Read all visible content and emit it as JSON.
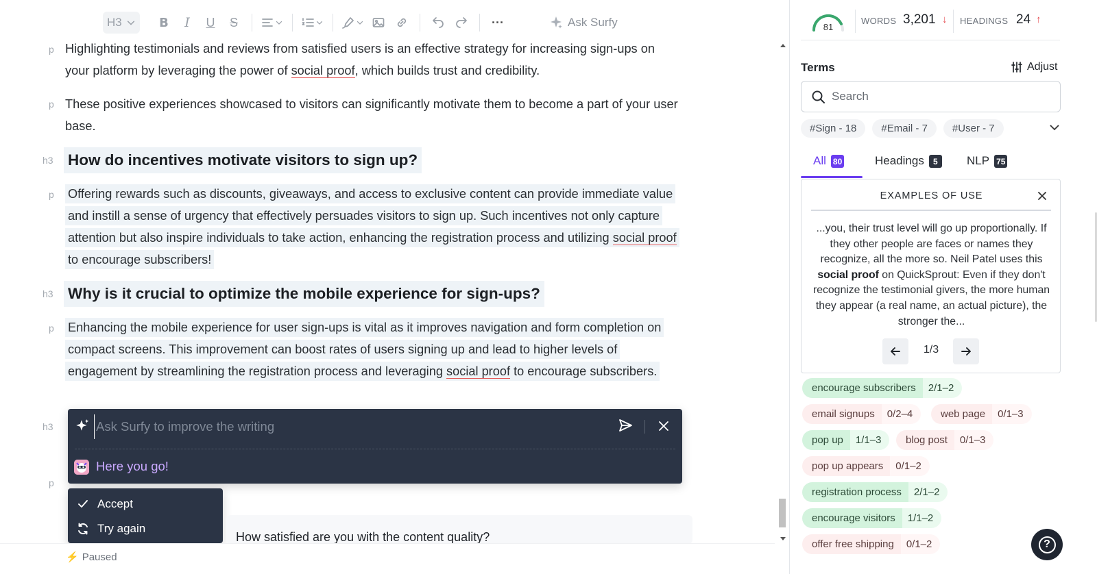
{
  "toolbar": {
    "heading_level": "H3",
    "bold": "B",
    "italic": "I",
    "underline": "U",
    "strike": "S",
    "more": "···",
    "ask_surfy": "Ask Surfy"
  },
  "editor": {
    "blocks": [
      {
        "tag": "p",
        "parts": [
          "Highlighting testimonials and reviews from satisfied users is an effective strategy for increasing sign-ups on your platform by leveraging the power of ",
          "social proof",
          ", which builds trust and credibility."
        ]
      },
      {
        "tag": "p",
        "text": "These positive experiences showcased to visitors can significantly motivate them to become a part of your user base."
      },
      {
        "tag": "h3",
        "text": "How do incentives motivate visitors to sign up?"
      },
      {
        "tag": "p",
        "parts": [
          "Offering rewards such as discounts, giveaways, and access to exclusive content can provide immediate value and instill a sense of urgency that effectively persuades visitors to sign up. Such incentives not only capture attention but also inspire individuals to take action, enhancing the registration process and utilizing ",
          "social proof",
          " to encourage subscribers!"
        ]
      },
      {
        "tag": "h3",
        "text": "Why is it crucial to optimize the mobile experience for sign-ups?"
      },
      {
        "tag": "p",
        "parts": [
          "Enhancing the mobile experience for user sign-ups is vital as it improves navigation and form completion on compact screens. This improvement can boost rates of users signing up and lead to higher levels of engagement by streamlining the registration process and leveraging ",
          "social proof",
          " to encourage subscribers."
        ]
      },
      {
        "tag": "h3"
      },
      {
        "tag": "p"
      }
    ],
    "ask_box": {
      "placeholder": "Ask Surfy to improve the writing",
      "reply": "Here you go!"
    },
    "menu": {
      "accept": "Accept",
      "try_again": "Try again"
    },
    "survey_question": "How satisfied are you with the content quality?",
    "status": "Paused"
  },
  "sidebar": {
    "score": "81",
    "words_label": "WORDS",
    "words_value": "3,201",
    "words_trend": "↓",
    "headings_label": "HEADINGS",
    "headings_value": "24",
    "headings_trend": "↑",
    "terms_title": "Terms",
    "adjust_label": "Adjust",
    "search_placeholder": "Search",
    "chips": [
      "#Sign - 18",
      "#Email - 7",
      "#User - 7"
    ],
    "tabs": [
      {
        "label": "All",
        "count": "80"
      },
      {
        "label": "Headings",
        "count": "5"
      },
      {
        "label": "NLP",
        "count": "75"
      }
    ],
    "examples": {
      "title": "EXAMPLES OF USE",
      "before": "...you, their trust level will go up proportionally. If they other people are faces or names they recognize, all the more so. Neil Patel uses this ",
      "highlight": "social proof",
      "after": " on QuickSprout: Even if they don't recognize the testimonial givers, the more human they appear (a real name, an actual picture), the stronger the...",
      "page": "1/3"
    },
    "terms": [
      {
        "name": "encourage subscribers",
        "count": "2/1–2",
        "status": "ok"
      },
      {
        "name": "email signups",
        "count": "0/2–4",
        "status": "bad"
      },
      {
        "name": "web page",
        "count": "0/1–3",
        "status": "bad"
      },
      {
        "name": "pop up",
        "count": "1/1–3",
        "status": "ok"
      },
      {
        "name": "blog post",
        "count": "0/1–3",
        "status": "bad"
      },
      {
        "name": "pop up appears",
        "count": "0/1–2",
        "status": "bad"
      },
      {
        "name": "registration process",
        "count": "2/1–2",
        "status": "ok"
      },
      {
        "name": "encourage visitors",
        "count": "1/1–2",
        "status": "ok"
      },
      {
        "name": "offer free shipping",
        "count": "0/1–2",
        "status": "bad"
      }
    ],
    "help": "?"
  },
  "colors": {
    "accent": "#6a3df0",
    "gauge": "#3aa76d",
    "ok": "#d3f3dd",
    "bad": "#fdeeee",
    "dark_panel": "#2b3445"
  }
}
